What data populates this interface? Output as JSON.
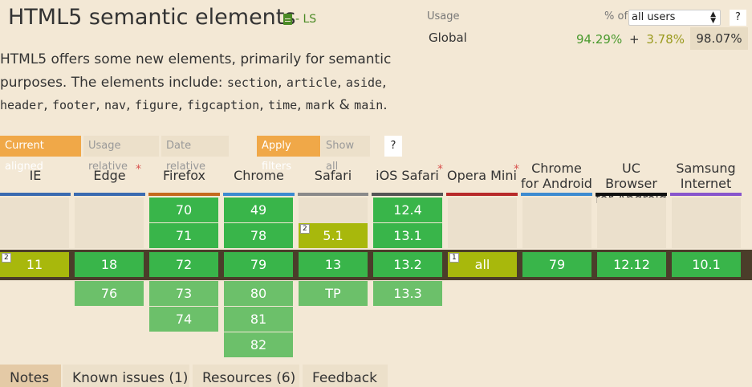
{
  "header": {
    "title": "HTML5 semantic elements",
    "status": "- LS",
    "description_parts": [
      {
        "text": "HTML5 offers some new elements, primarily for semantic purposes. The elements include: ",
        "code": false
      },
      {
        "text": "section",
        "code": true
      },
      {
        "text": ", ",
        "code": false
      },
      {
        "text": "article",
        "code": true
      },
      {
        "text": ", ",
        "code": false
      },
      {
        "text": "aside",
        "code": true
      },
      {
        "text": ", ",
        "code": false
      },
      {
        "text": "header",
        "code": true
      },
      {
        "text": ", ",
        "code": false
      },
      {
        "text": "footer",
        "code": true
      },
      {
        "text": ", ",
        "code": false
      },
      {
        "text": "nav",
        "code": true
      },
      {
        "text": ", ",
        "code": false
      },
      {
        "text": "figure",
        "code": true
      },
      {
        "text": ", ",
        "code": false
      },
      {
        "text": "figcaption",
        "code": true
      },
      {
        "text": ", ",
        "code": false
      },
      {
        "text": "time",
        "code": true
      },
      {
        "text": ", ",
        "code": false
      },
      {
        "text": "mark",
        "code": true
      },
      {
        "text": " & ",
        "code": false
      },
      {
        "text": "main",
        "code": true
      },
      {
        "text": ".",
        "code": false
      }
    ]
  },
  "usage": {
    "label": "Usage",
    "pct_of": "% of",
    "select_value": "all users",
    "help": "?",
    "region": "Global",
    "full": "94.29%",
    "plus": "+",
    "partial": "3.78%",
    "equals": "=",
    "total": "98.07%"
  },
  "filters": {
    "current_aligned": "Current aligned",
    "usage_relative": "Usage relative",
    "date_relative": "Date relative",
    "apply_filters": "Apply filters",
    "show_all": "Show all",
    "help": "?"
  },
  "browsers": [
    {
      "name": "IE",
      "color": "#3a6bb0"
    },
    {
      "name": "Edge",
      "color": "#3a6bb0",
      "star": "*"
    },
    {
      "name": "Firefox",
      "color": "#c46a1e"
    },
    {
      "name": "Chrome",
      "color": "#3d8bd0"
    },
    {
      "name": "Safari",
      "color": "#8a8a8a"
    },
    {
      "name": "iOS Safari",
      "color": "#555555",
      "star": "*"
    },
    {
      "name": "Opera Mini",
      "color": "#b82a2a",
      "star": "*"
    },
    {
      "name": "Chrome for Android",
      "color": "#3d8bd0"
    },
    {
      "name": "UC Browser for Android",
      "color": "#111111"
    },
    {
      "name": "Samsung Internet",
      "color": "#8855cc"
    }
  ],
  "rows": {
    "past2": [
      "",
      "",
      "70",
      "49",
      "",
      "12.4",
      "",
      "",
      "",
      ""
    ],
    "past1": [
      "",
      "",
      "71",
      "78",
      "5.1",
      "13.1",
      "",
      "",
      "",
      ""
    ],
    "current": [
      "11",
      "18",
      "72",
      "79",
      "13",
      "13.2",
      "all",
      "79",
      "12.12",
      "10.1"
    ],
    "future1": [
      "",
      "76",
      "73",
      "80",
      "TP",
      "13.3",
      "",
      "",
      "",
      ""
    ],
    "future2": [
      "",
      "",
      "74",
      "81",
      "",
      "",
      "",
      "",
      "",
      ""
    ],
    "future3": [
      "",
      "",
      "",
      "82",
      "",
      "",
      "",
      "",
      "",
      ""
    ]
  },
  "notes_markers": {
    "safari_5_1": "2",
    "ie_11": "2",
    "opera_mini_all": "1"
  },
  "tabs": [
    "Notes",
    "Known issues (1)",
    "Resources (6)",
    "Feedback"
  ]
}
